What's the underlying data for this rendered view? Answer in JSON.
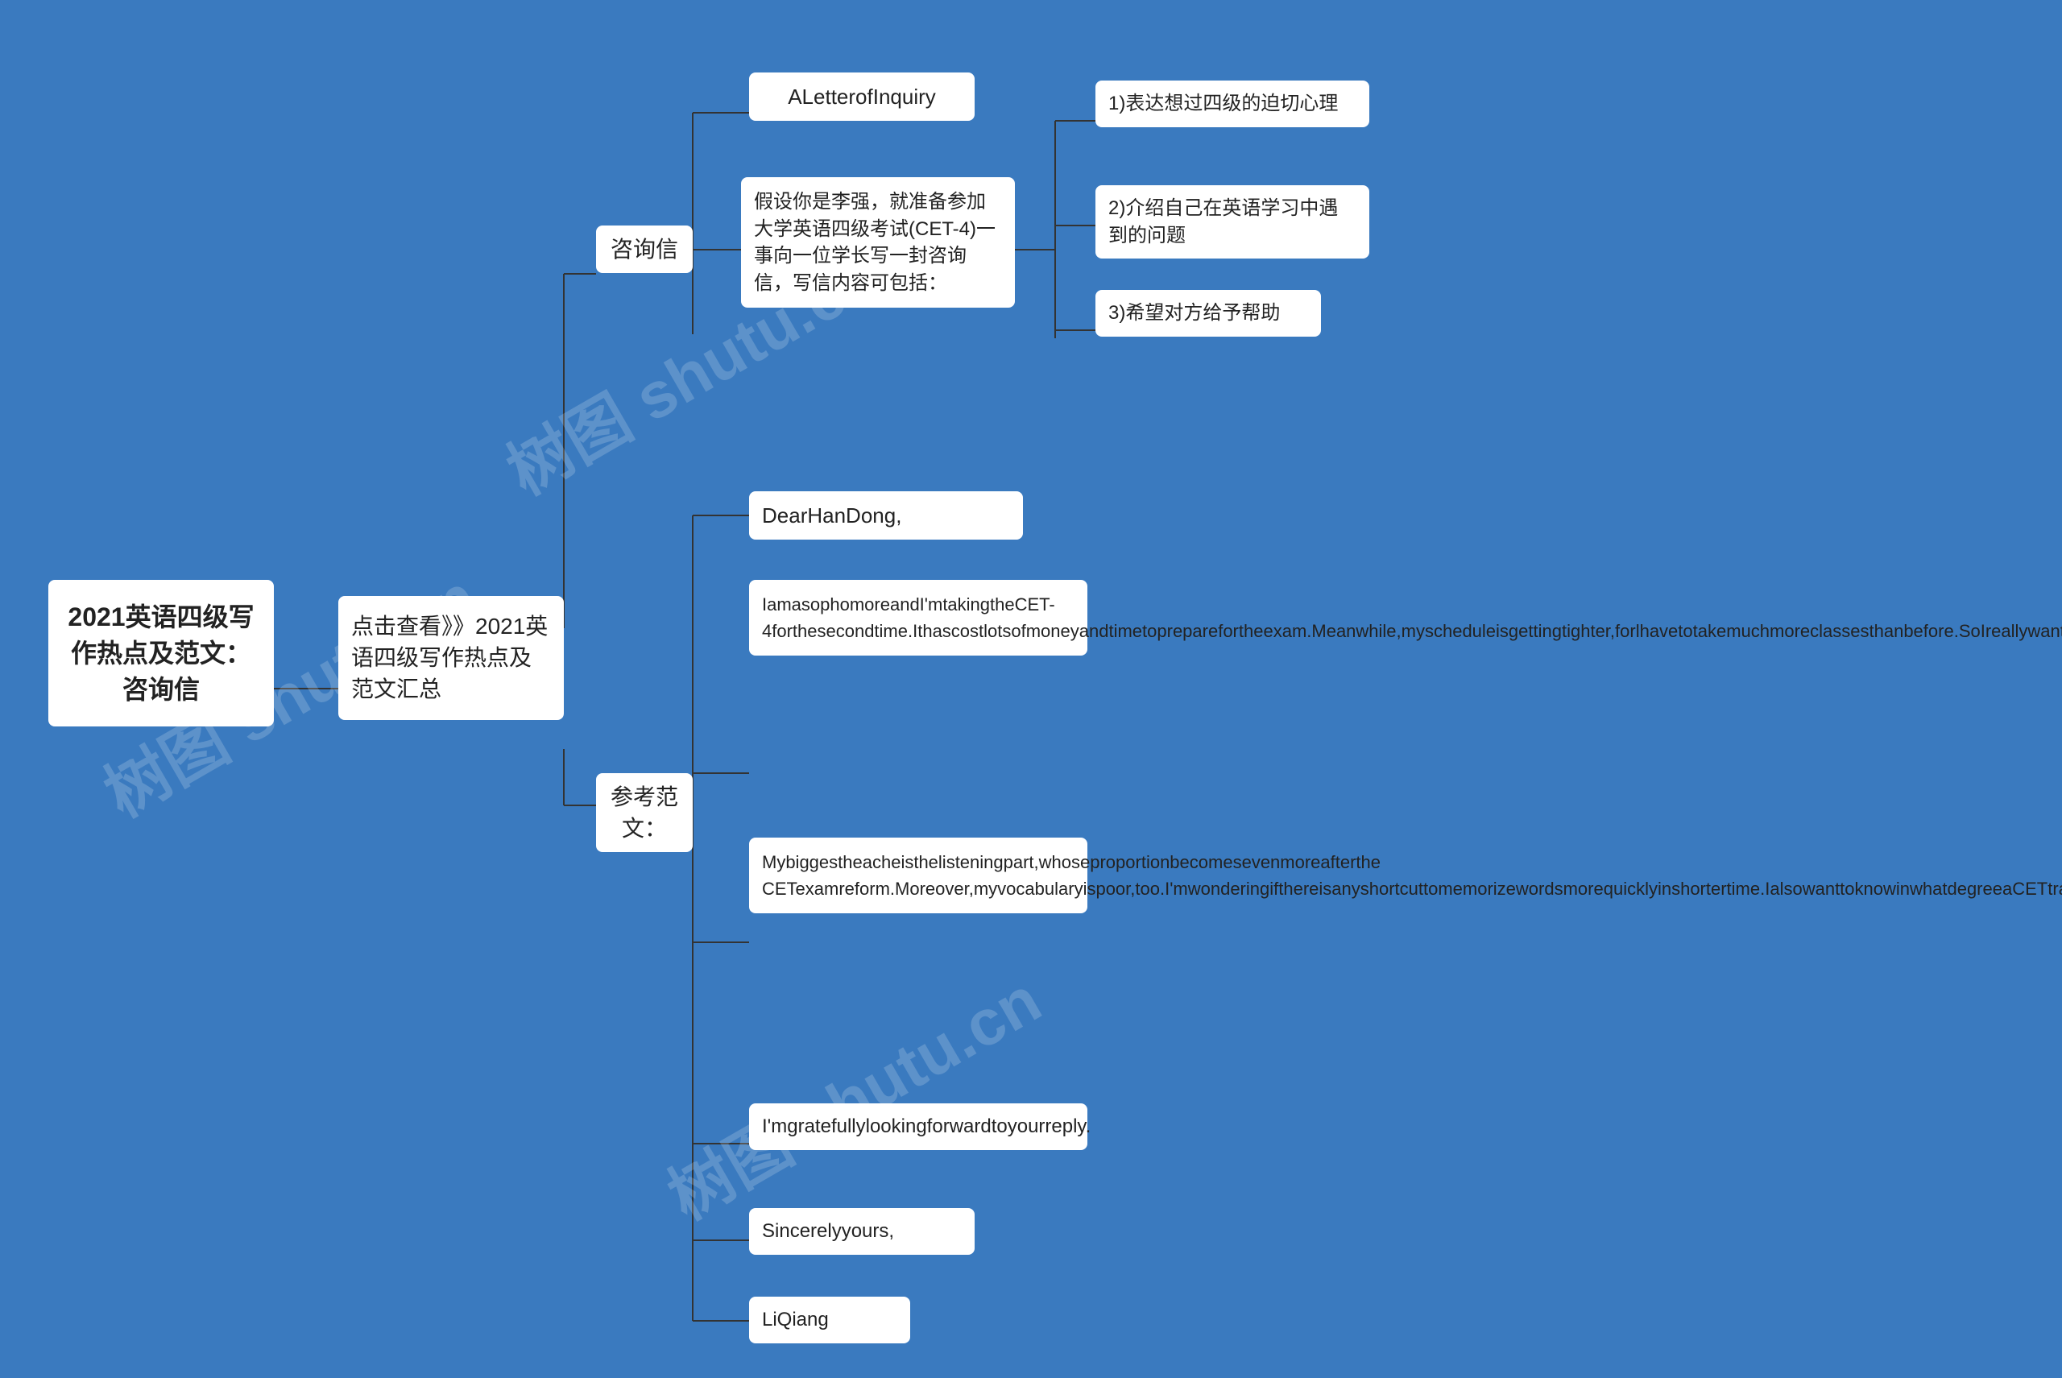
{
  "watermarks": [
    "树图 shutu.cn",
    "树图 shutu.cn",
    "树图 shutu.cn"
  ],
  "root": {
    "label": "2021英语四级写作热点及范文：咨询信"
  },
  "level1": {
    "label": "点击查看》》2021英语四级写作热点及范文汇总"
  },
  "consulting_node": {
    "label": "咨询信"
  },
  "sample_node": {
    "label": "参考范文："
  },
  "letter_node": {
    "label": "ALetterofInquiry"
  },
  "prompt_node": {
    "label": "假设你是李强，就准备参加大学英语四级考试(CET-4)一事向一位学长写一封咨询信，写信内容可包括："
  },
  "points": [
    "1)表达想过四级的迫切心理",
    "2)介绍自己在英语学习中遇到的问题",
    "3)希望对方给予帮助"
  ],
  "dear_node": {
    "label": "DearHanDong,"
  },
  "para1_node": {
    "label": "IamasophomoreandI'mtakingtheCET-4forthesecondtime.Ithascostlotsofmoneyandtimetopreparefortheexam.Meanwhile,myscheduleisgettingtighter,forlhavetotakemuchmoreclassesthanbefore.SoIreallywanttomakethingsworkthistime.That'swhyI'mwritingtoyouforhelp."
  },
  "para2_node": {
    "label": "Mybiggestheacheisthelisteningpart,whoseproportionbecomesevenmoreafterthe CETexamreform.Moreover,myvocabularyispoor,too.I'mwonderingifthereisanyshortcuttomemorizewordsmorequicklyinshortertime.IalsowanttoknowinwhatdegreeaCETtrainingclasscanhelp.Finally,Ineedyourecommendsomebetterbookstome."
  },
  "gratefully_node": {
    "label": "I'mgratefullylookingforwardtoyourreply."
  },
  "sincerely_node": {
    "label": "Sincerelyyours,"
  },
  "liqiang_node": {
    "label": "LiQiang"
  }
}
